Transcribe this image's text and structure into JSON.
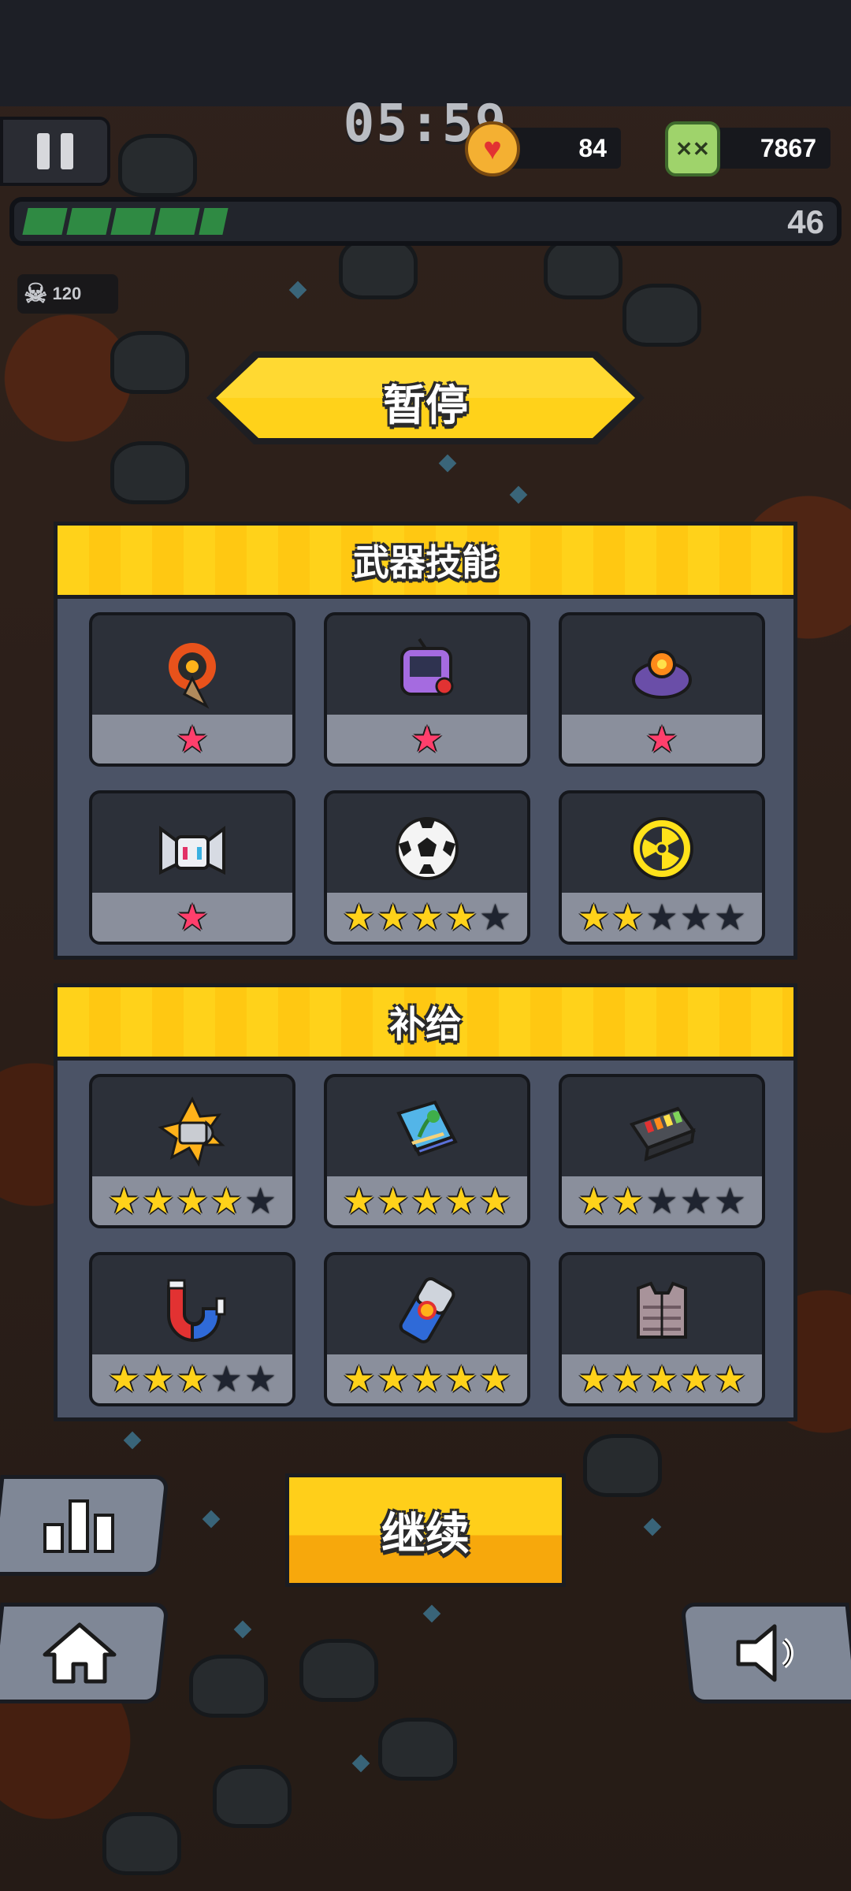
{
  "hud": {
    "timer": "05:59",
    "hearts": "84",
    "kills": "7867",
    "level": "46",
    "xp_progress": 0.17,
    "ghost_count": "120"
  },
  "title": "暂停",
  "weapons_panel": {
    "title": "武器技能",
    "slots": [
      {
        "icon": "flaming-drill-icon",
        "stars": 1,
        "style": "pink"
      },
      {
        "icon": "arcade-console-icon",
        "stars": 1,
        "style": "pink"
      },
      {
        "icon": "orb-turret-icon",
        "stars": 1,
        "style": "pink"
      },
      {
        "icon": "robot-drone-icon",
        "stars": 1,
        "style": "pink"
      },
      {
        "icon": "soccer-ball-icon",
        "stars": 4,
        "style": "gold"
      },
      {
        "icon": "radiation-disc-icon",
        "stars": 2,
        "style": "gold"
      }
    ]
  },
  "supplies_panel": {
    "title": "补给",
    "slots": [
      {
        "icon": "bullet-icon",
        "stars": 4
      },
      {
        "icon": "book-icon",
        "stars": 5
      },
      {
        "icon": "battery-pack-icon",
        "stars": 2
      },
      {
        "icon": "magnet-icon",
        "stars": 3
      },
      {
        "icon": "energy-can-icon",
        "stars": 5
      },
      {
        "icon": "armor-vest-icon",
        "stars": 5
      }
    ]
  },
  "buttons": {
    "continue_label": "继续",
    "stats_icon": "bar-chart-icon",
    "home_icon": "home-icon",
    "sound_icon": "speaker-icon"
  },
  "colors": {
    "accent_yellow": "#ffd21a",
    "panel_bg": "#4b5366",
    "slot_bg": "#2c3039",
    "star_gold": "#ffd21a",
    "star_pink": "#ff3f6c",
    "xp_green": "#2f8a43"
  }
}
